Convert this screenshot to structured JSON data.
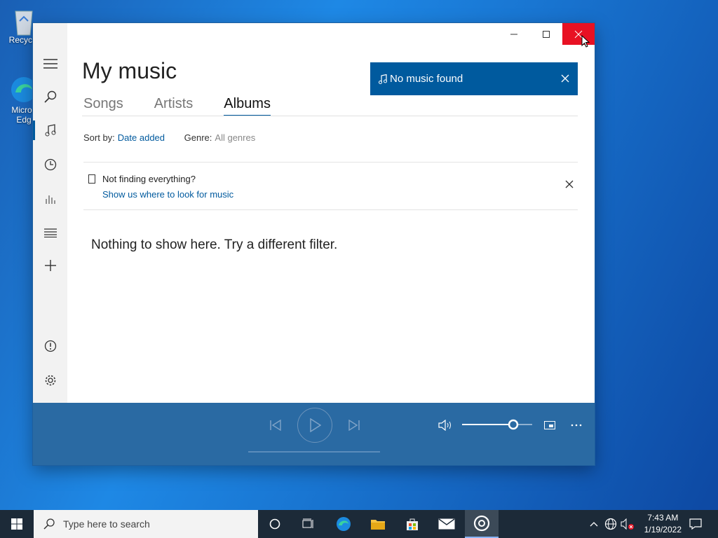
{
  "desktop": {
    "recycle_label": "Recycle",
    "edge_label_1": "Micros",
    "edge_label_2": "Edg"
  },
  "window": {
    "title": "My music",
    "tabs": [
      {
        "label": "Songs"
      },
      {
        "label": "Artists"
      },
      {
        "label": "Albums"
      }
    ],
    "sort_label": "Sort by:",
    "sort_value": "Date added",
    "genre_label": "Genre:",
    "genre_value": "All genres",
    "notice_title": "Not finding everything?",
    "notice_link": "Show us where to look for music",
    "empty_message": "Nothing to show here. Try a different filter.",
    "toast": "No music found",
    "accent": "#005a9e"
  },
  "player": {
    "volume_fraction": 0.73
  },
  "taskbar": {
    "search_placeholder": "Type here to search",
    "time": "7:43 AM",
    "date": "1/19/2022"
  }
}
